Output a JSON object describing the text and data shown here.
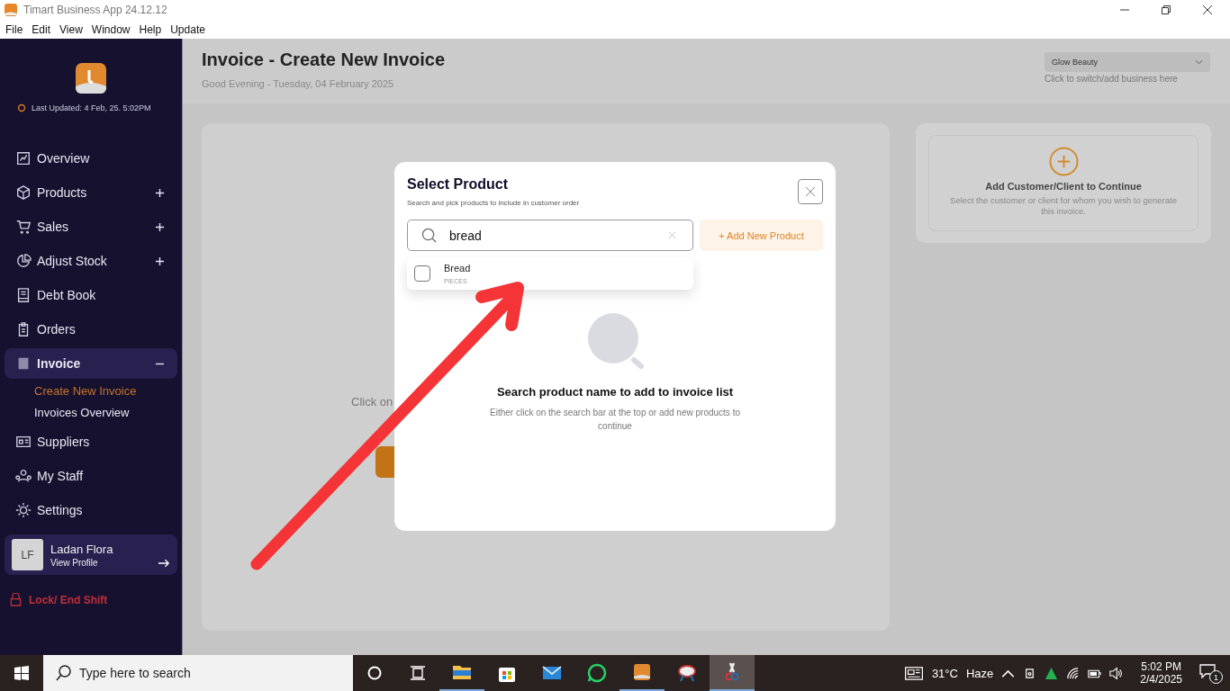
{
  "window": {
    "title": "Timart Business App 24.12.12"
  },
  "menu": [
    "File",
    "Edit",
    "View",
    "Window",
    "Help",
    "Update"
  ],
  "sidebar": {
    "last_updated": "Last Updated: 4 Feb, 25. 5:02PM",
    "items": [
      {
        "label": "Overview",
        "selected": false
      },
      {
        "label": "Products",
        "selected": false,
        "expanded": false
      },
      {
        "label": "Sales",
        "selected": false,
        "expanded": false
      },
      {
        "label": "Adjust Stock",
        "selected": false,
        "expanded": false
      },
      {
        "label": "Debt Book",
        "selected": false
      },
      {
        "label": "Orders",
        "selected": false
      },
      {
        "label": "Invoice",
        "selected": true,
        "expanded": true,
        "children": [
          {
            "label": "Create New Invoice",
            "selected": true
          },
          {
            "label": "Invoices Overview",
            "selected": false
          }
        ]
      },
      {
        "label": "Suppliers",
        "selected": false
      },
      {
        "label": "My Staff",
        "selected": false
      },
      {
        "label": "Settings",
        "selected": false
      }
    ],
    "profile": {
      "initials": "LF",
      "name": "Ladan Flora",
      "link": "View Profile"
    },
    "lock": "Lock/ End Shift"
  },
  "header": {
    "title": "Invoice - Create New Invoice",
    "subtitle": "Good Evening - Tuesday, 04 February 2025",
    "business": "Glow Beauty",
    "business_hint": "Click to switch/add business here"
  },
  "main_card": {
    "text": "Click on"
  },
  "customer_card": {
    "title": "Add Customer/Client to Continue",
    "text": "Select the customer or client for whom you wish to generate this invoice."
  },
  "modal": {
    "title": "Select Product",
    "subtitle": "Search and pick products to include in customer order",
    "search": {
      "value": "bread"
    },
    "add_button": "+ Add New Product",
    "results": [
      {
        "name": "Bread",
        "unit": "PIECES",
        "checked": false
      }
    ],
    "empty_title": "Search product name to add to invoice list",
    "empty_text": "Either click on the search bar at the top or add new products to continue"
  },
  "taskbar": {
    "search_placeholder": "Type here to search",
    "apps": [
      {
        "running": true,
        "selected": false
      },
      {
        "running": false,
        "selected": false
      },
      {
        "running": false,
        "selected": false
      },
      {
        "running": false,
        "selected": false
      },
      {
        "running": true,
        "selected": false
      },
      {
        "running": false,
        "selected": false
      },
      {
        "running": true,
        "selected": true
      }
    ],
    "temperature": "31°C",
    "weather": "Haze",
    "time": "5:02 PM",
    "date": "2/4/2025",
    "notifications": "1"
  }
}
